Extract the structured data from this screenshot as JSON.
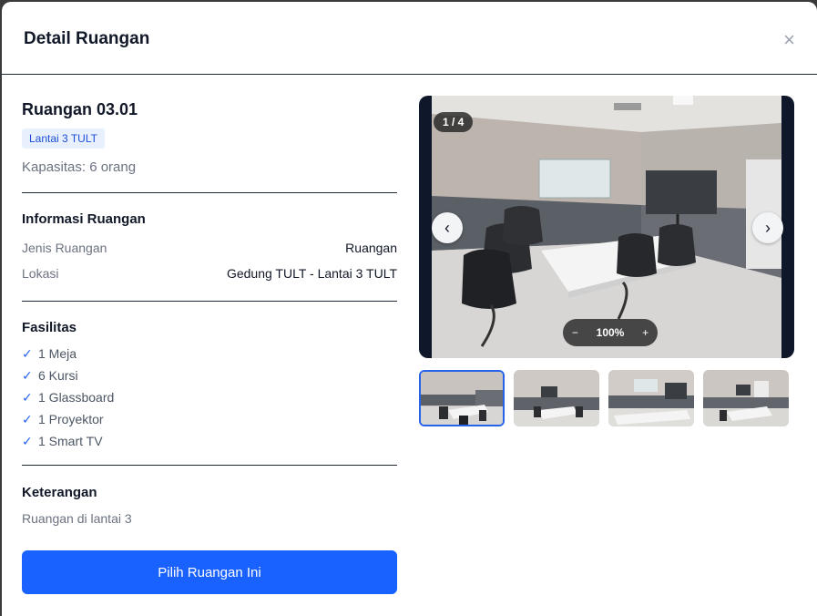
{
  "modal": {
    "title": "Detail Ruangan",
    "close": "×"
  },
  "room": {
    "name": "Ruangan 03.01",
    "floor_badge": "Lantai 3 TULT",
    "capacity": "Kapasitas: 6 orang"
  },
  "info": {
    "title": "Informasi Ruangan",
    "rows": [
      {
        "label": "Jenis Ruangan",
        "value": "Ruangan"
      },
      {
        "label": "Lokasi",
        "value": "Gedung TULT - Lantai 3 TULT"
      }
    ]
  },
  "facilities": {
    "title": "Fasilitas",
    "check": "✓",
    "items": [
      "1 Meja",
      "6 Kursi",
      "1 Glassboard",
      "1 Proyektor",
      "1 Smart TV"
    ]
  },
  "notes": {
    "title": "Keterangan",
    "text": "Ruangan di lantai 3"
  },
  "action": {
    "select_label": "Pilih Ruangan Ini"
  },
  "gallery": {
    "counter": "1 / 4",
    "prev": "‹",
    "next": "›",
    "zoom_out": "−",
    "zoom_level": "100%",
    "zoom_in": "+",
    "selected_thumbnail": 1,
    "thumbnail_count": 4
  },
  "colors": {
    "primary": "#1a62ff",
    "badge_bg": "#e8f0fe",
    "check": "#2563eb"
  }
}
